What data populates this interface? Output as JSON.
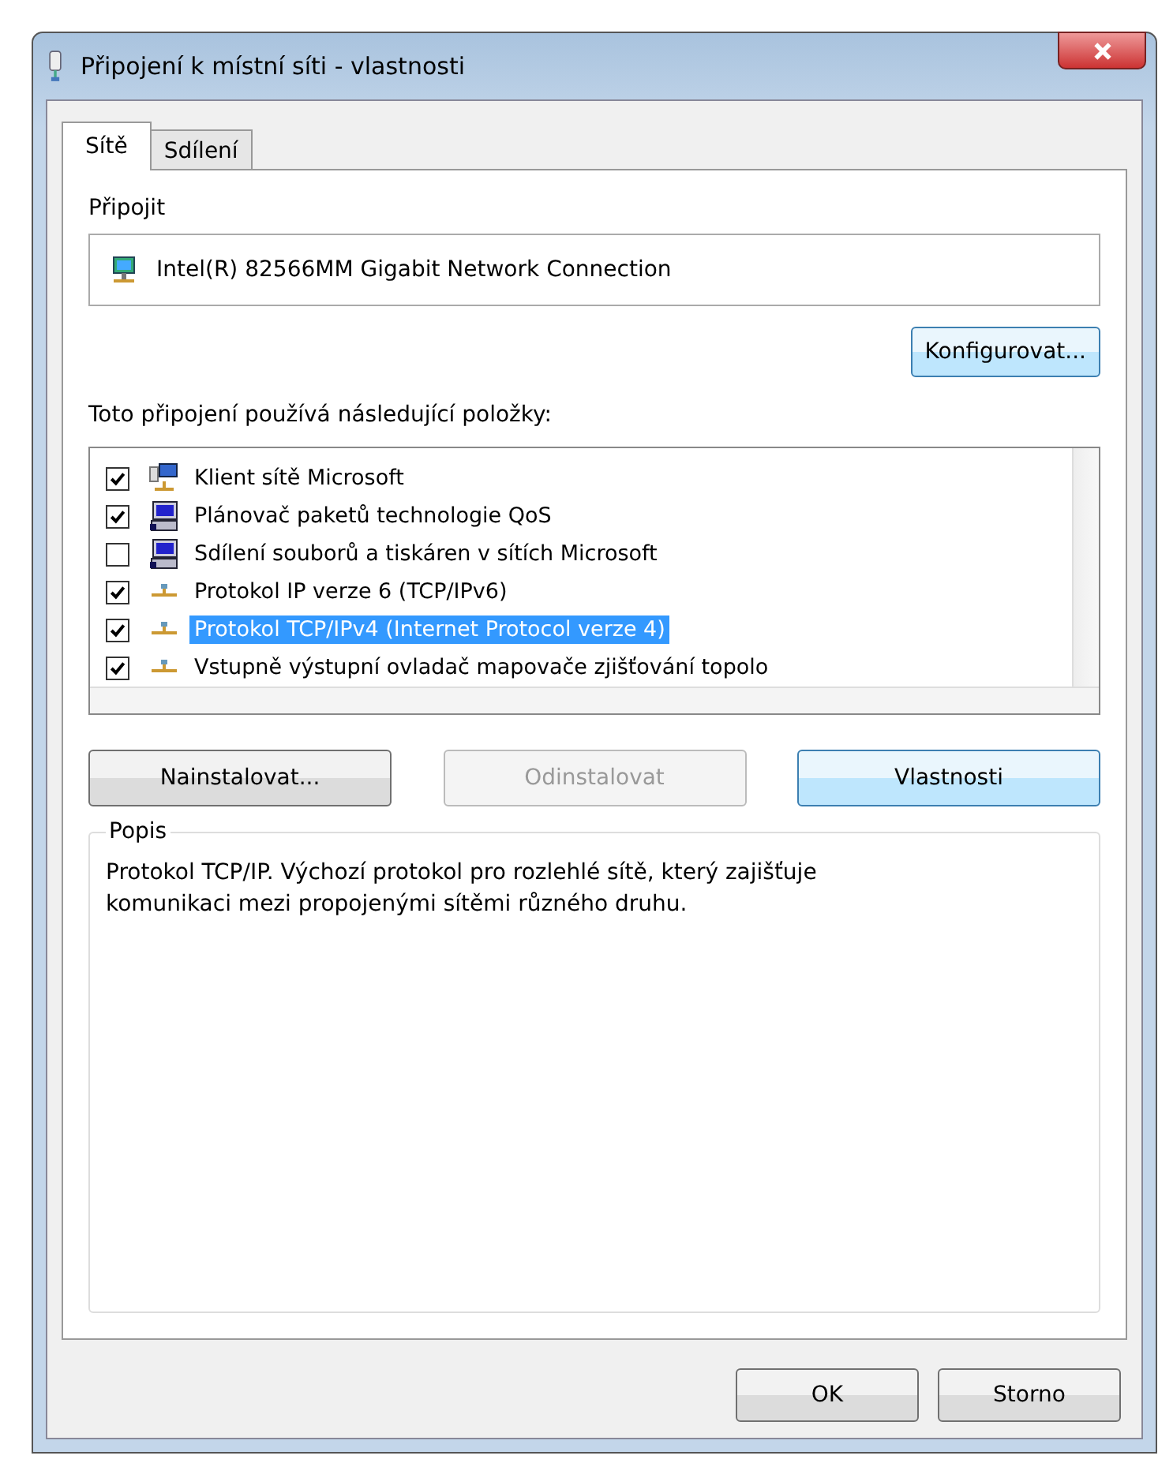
{
  "window": {
    "title": "Připojení k místní síti - vlastnosti"
  },
  "tabs": [
    {
      "label": "Sítě",
      "selected": true
    },
    {
      "label": "Sdílení",
      "selected": false
    }
  ],
  "connect_label": "Připojit",
  "adapter": {
    "name": "Intel(R) 82566MM Gigabit Network Connection"
  },
  "configure_button": "Konfigurovat...",
  "items_label": "Toto připojení používá následující položky:",
  "items": [
    {
      "label": "Klient sítě Microsoft",
      "checked": true,
      "selected": false,
      "kind": "client"
    },
    {
      "label": "Plánovač paketů technologie QoS",
      "checked": true,
      "selected": false,
      "kind": "service"
    },
    {
      "label": "Sdílení souborů a tiskáren v sítích Microsoft",
      "checked": false,
      "selected": false,
      "kind": "service"
    },
    {
      "label": "Protokol IP verze 6 (TCP/IPv6)",
      "checked": true,
      "selected": false,
      "kind": "protocol"
    },
    {
      "label": "Protokol TCP/IPv4 (Internet Protocol verze 4)",
      "checked": true,
      "selected": true,
      "kind": "protocol"
    },
    {
      "label": "Vstupně výstupní ovladač mapovače zjišťování topolo",
      "checked": true,
      "selected": false,
      "kind": "protocol"
    }
  ],
  "action_buttons": [
    {
      "label": "Nainstalovat...",
      "disabled": false,
      "highlighted": false
    },
    {
      "label": "Odinstalovat",
      "disabled": true,
      "highlighted": false
    },
    {
      "label": "Vlastnosti",
      "disabled": false,
      "highlighted": true
    }
  ],
  "description": {
    "title": "Popis",
    "text": "Protokol TCP/IP. Výchozí protokol pro rozlehlé sítě, který zajišťuje komunikaci mezi propojenými sítěmi různého druhu."
  },
  "buttons": [
    "OK",
    "Storno"
  ]
}
